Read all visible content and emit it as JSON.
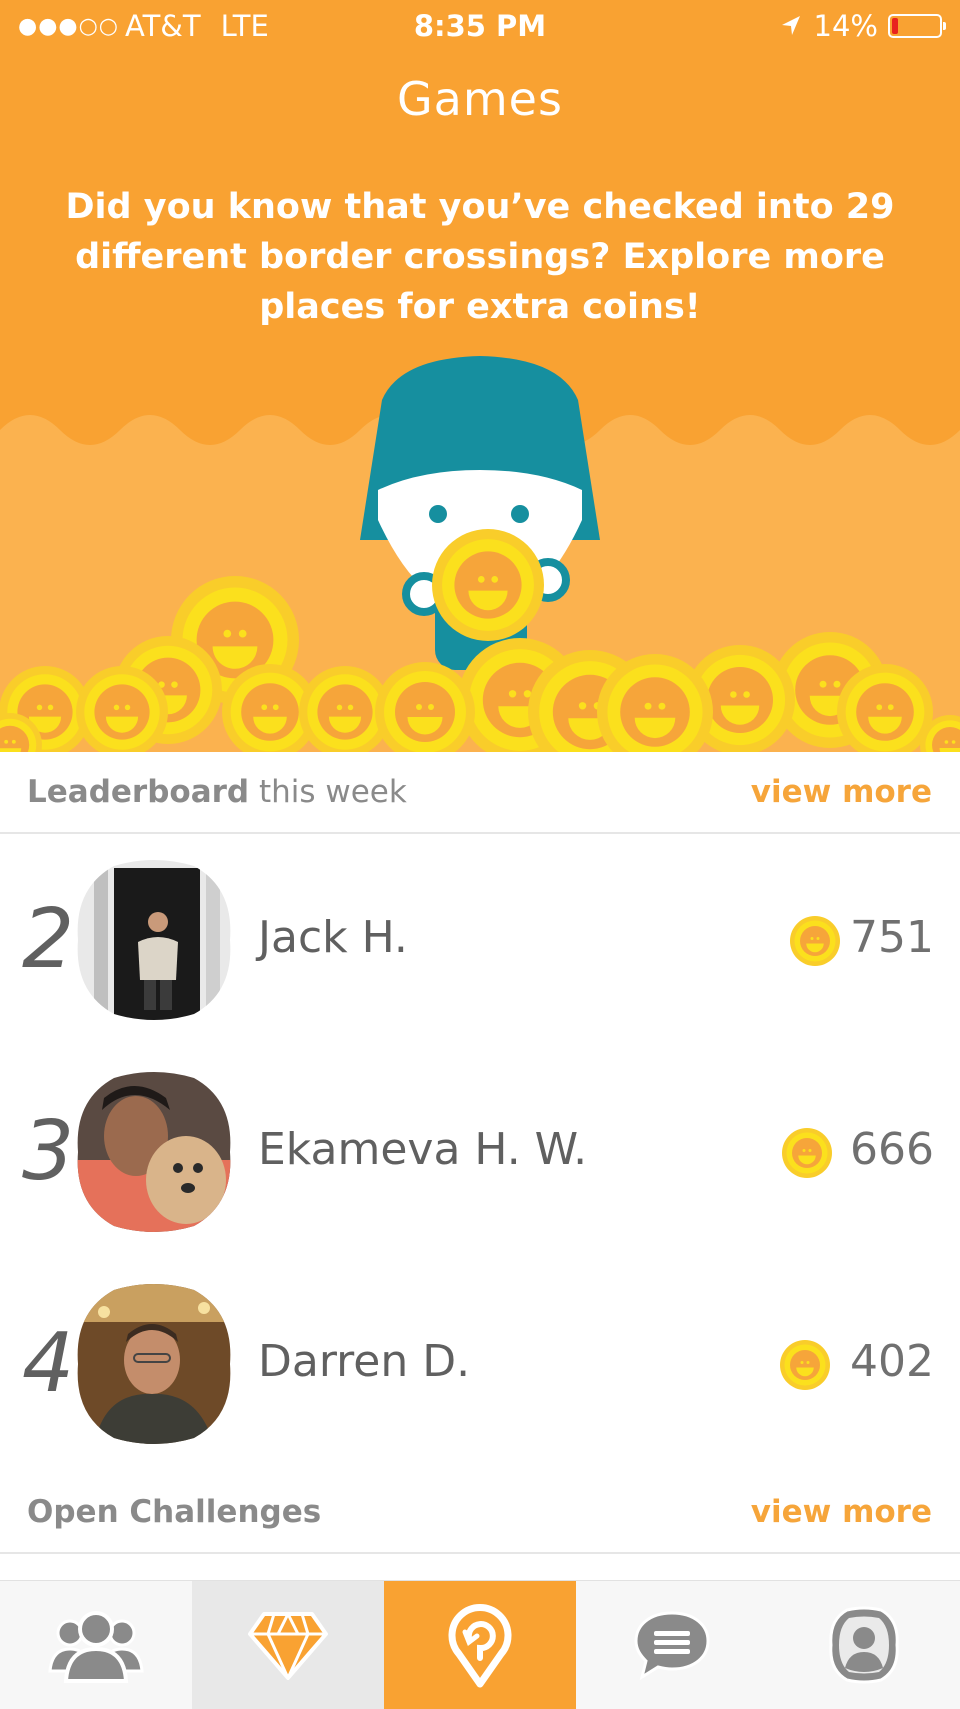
{
  "status_bar": {
    "signal_dots": "●●●○○",
    "carrier": "AT&T",
    "network": "LTE",
    "time": "8:35 PM",
    "battery_percent": "14%",
    "battery_level": 0.14
  },
  "header": {
    "title": "Games",
    "tip": "Did you know that you’ve checked into 29 different border crossings? Explore more places for extra coins!"
  },
  "leaderboard": {
    "title_bold": "Leaderboard",
    "title_rest": " this week",
    "view_more": "view more",
    "entries": [
      {
        "rank": "2",
        "name": "Jack H.",
        "coins": "751"
      },
      {
        "rank": "3",
        "name": "Ekameva H. W.",
        "coins": "666"
      },
      {
        "rank": "4",
        "name": "Darren D.",
        "coins": "402"
      }
    ]
  },
  "challenges": {
    "title": "Open Challenges",
    "view_more": "view more"
  },
  "tabbar": {
    "tabs": [
      {
        "icon": "friends-icon",
        "state": "normal"
      },
      {
        "icon": "diamond-icon",
        "state": "highlighted"
      },
      {
        "icon": "check-in-icon",
        "state": "active"
      },
      {
        "icon": "messages-icon",
        "state": "normal"
      },
      {
        "icon": "profile-icon",
        "state": "normal"
      }
    ]
  },
  "colors": {
    "orange": "#f9a232",
    "coin_yellow": "#fbd22a",
    "teal": "#168f9f",
    "link_orange": "#f6a53a"
  }
}
